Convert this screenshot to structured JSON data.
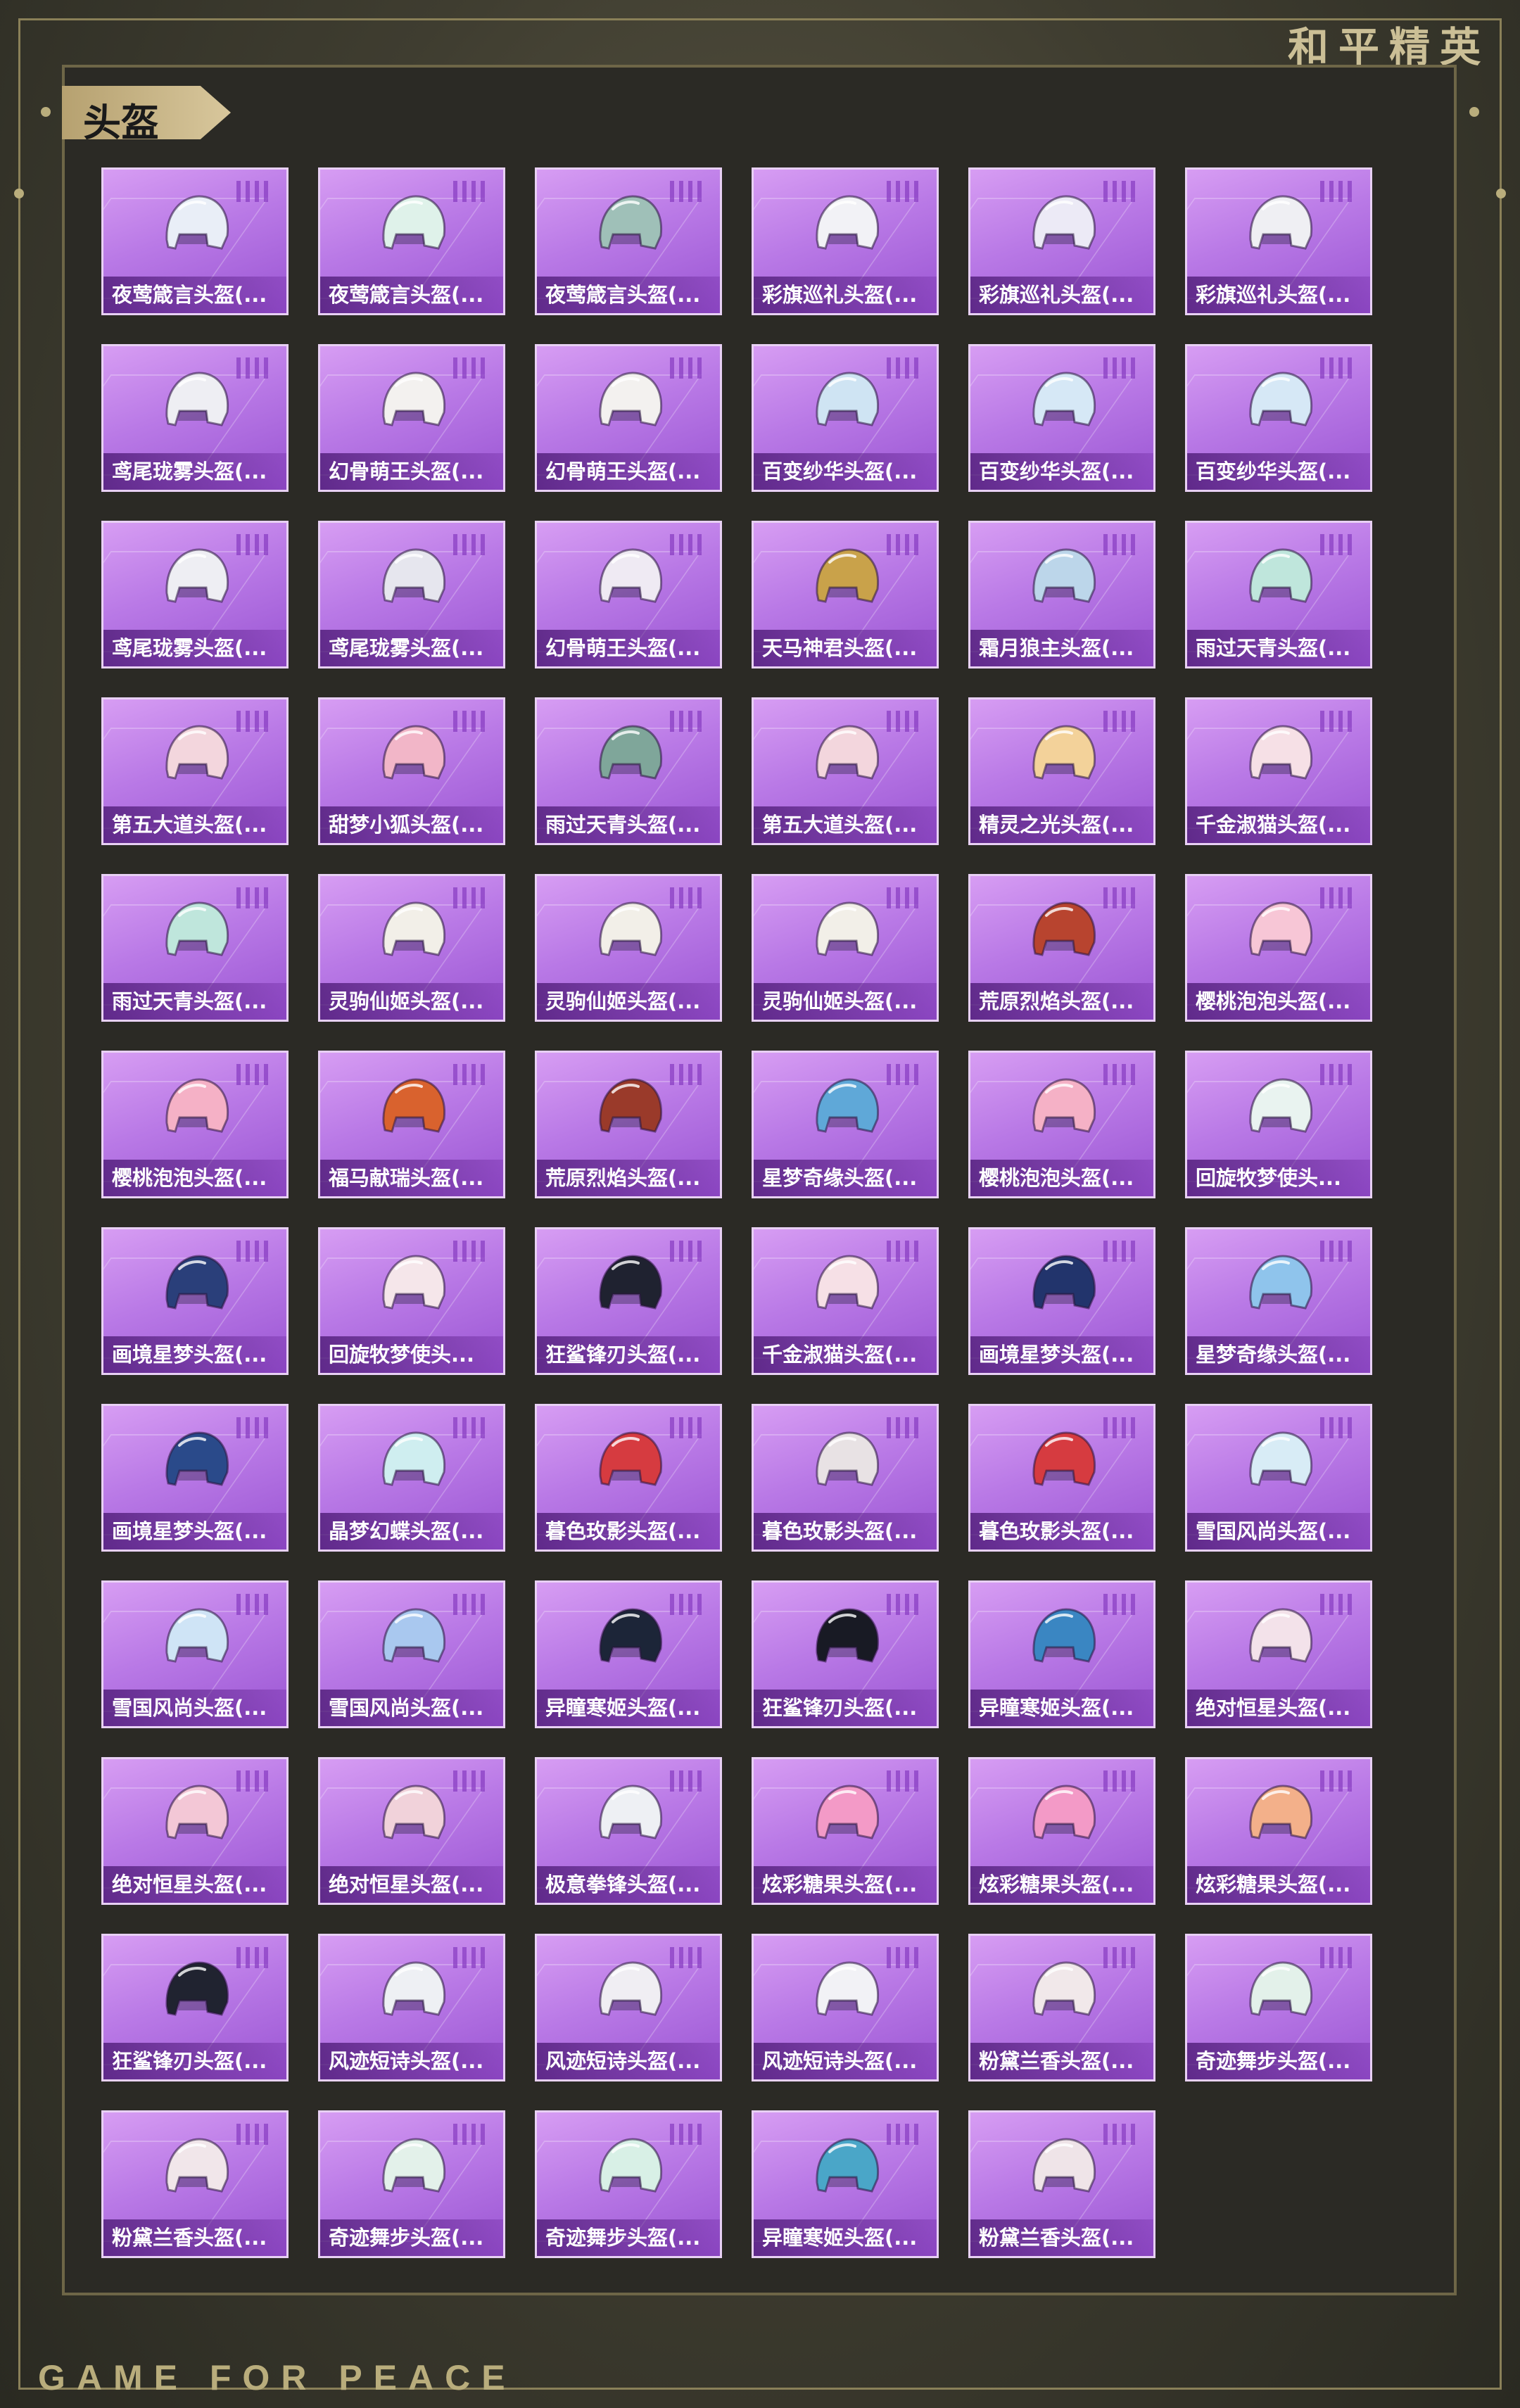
{
  "brand": {
    "top_text": "和平精英",
    "bottom_text": "GAME FOR PEACE"
  },
  "section": {
    "title": "头盔"
  },
  "items": [
    {
      "label": "夜莺箴言头盔(...",
      "color": "#e9eef7"
    },
    {
      "label": "夜莺箴言头盔(...",
      "color": "#dff2ea"
    },
    {
      "label": "夜莺箴言头盔(...",
      "color": "#9fc0b8"
    },
    {
      "label": "彩旗巡礼头盔(...",
      "color": "#f2f2f6"
    },
    {
      "label": "彩旗巡礼头盔(...",
      "color": "#eceaf6"
    },
    {
      "label": "彩旗巡礼头盔(...",
      "color": "#efeff3"
    },
    {
      "label": "鸢尾珑雾头盔(...",
      "color": "#eeeef3"
    },
    {
      "label": "幻骨萌王头盔(...",
      "color": "#f3f1ef"
    },
    {
      "label": "幻骨萌王头盔(...",
      "color": "#f3f1ef"
    },
    {
      "label": "百变纱华头盔(...",
      "color": "#cfe4f3"
    },
    {
      "label": "百变纱华头盔(...",
      "color": "#d6e8f6"
    },
    {
      "label": "百变纱华头盔(...",
      "color": "#d6e8f6"
    },
    {
      "label": "鸢尾珑雾头盔(...",
      "color": "#eeeef3"
    },
    {
      "label": "鸢尾珑雾头盔(...",
      "color": "#e6e6ee"
    },
    {
      "label": "幻骨萌王头盔(...",
      "color": "#efeaf3"
    },
    {
      "label": "天马神君头盔(...",
      "color": "#c9a24a"
    },
    {
      "label": "霜月狼主头盔(...",
      "color": "#bcd6ea"
    },
    {
      "label": "雨过天青头盔(...",
      "color": "#bfe6dc"
    },
    {
      "label": "第五大道头盔(...",
      "color": "#f3d6dd"
    },
    {
      "label": "甜梦小狐头盔(...",
      "color": "#f2b6c8"
    },
    {
      "label": "雨过天青头盔(...",
      "color": "#7fa69a"
    },
    {
      "label": "第五大道头盔(...",
      "color": "#f3d6dd"
    },
    {
      "label": "精灵之光头盔(...",
      "color": "#f3d29a"
    },
    {
      "label": "千金淑猫头盔(...",
      "color": "#f6e0e6"
    },
    {
      "label": "雨过天青头盔(...",
      "color": "#bfe6dc"
    },
    {
      "label": "灵驹仙姬头盔(...",
      "color": "#f2efe8"
    },
    {
      "label": "灵驹仙姬头盔(...",
      "color": "#f2efe8"
    },
    {
      "label": "灵驹仙姬头盔(...",
      "color": "#f2efe8"
    },
    {
      "label": "荒原烈焰头盔(...",
      "color": "#b8442f"
    },
    {
      "label": "樱桃泡泡头盔(...",
      "color": "#f7c6d6"
    },
    {
      "label": "樱桃泡泡头盔(...",
      "color": "#f5b1c6"
    },
    {
      "label": "福马献瑞头盔(...",
      "color": "#d9622e"
    },
    {
      "label": "荒原烈焰头盔(...",
      "color": "#9a3a2a"
    },
    {
      "label": "星梦奇缘头盔(...",
      "color": "#5fa8d8"
    },
    {
      "label": "樱桃泡泡头盔(...",
      "color": "#f5b1c6"
    },
    {
      "label": "回旋牧梦使头...",
      "color": "#e9f3f0"
    },
    {
      "label": "画境星梦头盔(...",
      "color": "#2a3f7a"
    },
    {
      "label": "回旋牧梦使头...",
      "color": "#f5e6ea"
    },
    {
      "label": "狂鲨锋刃头盔(...",
      "color": "#1f2230"
    },
    {
      "label": "千金淑猫头盔(...",
      "color": "#f6e0e6"
    },
    {
      "label": "画境星梦头盔(...",
      "color": "#22346c"
    },
    {
      "label": "星梦奇缘头盔(...",
      "color": "#8fc4ec"
    },
    {
      "label": "画境星梦头盔(...",
      "color": "#2a4a8a"
    },
    {
      "label": "晶梦幻蝶头盔(...",
      "color": "#cfeef0"
    },
    {
      "label": "暮色玫影头盔(...",
      "color": "#d63b40"
    },
    {
      "label": "暮色玫影头盔(...",
      "color": "#e8e2e4"
    },
    {
      "label": "暮色玫影头盔(...",
      "color": "#d63b40"
    },
    {
      "label": "雪国风尚头盔(...",
      "color": "#d8ecf6"
    },
    {
      "label": "雪国风尚头盔(...",
      "color": "#cfe4f6"
    },
    {
      "label": "雪国风尚头盔(...",
      "color": "#a9c8ef"
    },
    {
      "label": "异瞳寒姬头盔(...",
      "color": "#1c2538"
    },
    {
      "label": "狂鲨锋刃头盔(...",
      "color": "#181a24"
    },
    {
      "label": "异瞳寒姬头盔(...",
      "color": "#3a86c2"
    },
    {
      "label": "绝对恒星头盔(...",
      "color": "#f3e2ea"
    },
    {
      "label": "绝对恒星头盔(...",
      "color": "#f3c7d6"
    },
    {
      "label": "绝对恒星头盔(...",
      "color": "#f1d2da"
    },
    {
      "label": "极意拳锋头盔(...",
      "color": "#eef0f4"
    },
    {
      "label": "炫彩糖果头盔(...",
      "color": "#f39ac7"
    },
    {
      "label": "炫彩糖果头盔(...",
      "color": "#f39ac7"
    },
    {
      "label": "炫彩糖果头盔(...",
      "color": "#f3b08a"
    },
    {
      "label": "狂鲨锋刃头盔(...",
      "color": "#202330"
    },
    {
      "label": "风迹短诗头盔(...",
      "color": "#eef0f4"
    },
    {
      "label": "风迹短诗头盔(...",
      "color": "#f0eef3"
    },
    {
      "label": "风迹短诗头盔(...",
      "color": "#f2f2f6"
    },
    {
      "label": "粉黛兰香头盔(...",
      "color": "#f1e8ea"
    },
    {
      "label": "奇迹舞步头盔(...",
      "color": "#e3f1ea"
    },
    {
      "label": "粉黛兰香头盔(...",
      "color": "#f1e6ea"
    },
    {
      "label": "奇迹舞步头盔(...",
      "color": "#e3f1ea"
    },
    {
      "label": "奇迹舞步头盔(...",
      "color": "#d8f0e6"
    },
    {
      "label": "异瞳寒姬头盔(...",
      "color": "#4aa6c8"
    },
    {
      "label": "粉黛兰香头盔(...",
      "color": "#efe4e8"
    }
  ]
}
